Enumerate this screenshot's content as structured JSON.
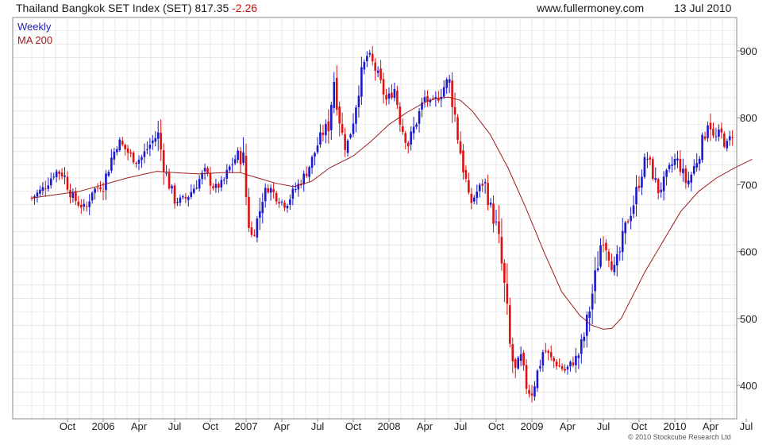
{
  "header": {
    "title": "Thailand Bangkok SET Index (SET) 817.35",
    "change": "-2.26",
    "site": "www.fullermoney.com",
    "date": "13 Jul 2010"
  },
  "legend": {
    "weekly": "Weekly",
    "ma": "MA 200"
  },
  "credit": "© 2010 Stockcube Research Ltd",
  "colors": {
    "up": "#1a1acc",
    "down": "#dd1111",
    "ma": "#9b1c1c",
    "grid": "#dcdcdc"
  },
  "chart_data": {
    "type": "candlestick",
    "x_unit": "months since Jul 2005",
    "x_ticks": [
      {
        "m": 3,
        "label": "Oct"
      },
      {
        "m": 6,
        "label": "2006"
      },
      {
        "m": 9,
        "label": "Apr"
      },
      {
        "m": 12,
        "label": "Jul"
      },
      {
        "m": 15,
        "label": "Oct"
      },
      {
        "m": 18,
        "label": "2007"
      },
      {
        "m": 21,
        "label": "Apr"
      },
      {
        "m": 24,
        "label": "Jul"
      },
      {
        "m": 27,
        "label": "Oct"
      },
      {
        "m": 30,
        "label": "2008"
      },
      {
        "m": 33,
        "label": "Apr"
      },
      {
        "m": 36,
        "label": "Jul"
      },
      {
        "m": 39,
        "label": "Oct"
      },
      {
        "m": 42,
        "label": "2009"
      },
      {
        "m": 45,
        "label": "Apr"
      },
      {
        "m": 48,
        "label": "Jul"
      },
      {
        "m": 51,
        "label": "Oct"
      },
      {
        "m": 54,
        "label": "2010"
      },
      {
        "m": 57,
        "label": "Apr"
      },
      {
        "m": 60,
        "label": "Jul"
      }
    ],
    "y_ticks": [
      400,
      500,
      600,
      700,
      800,
      900
    ],
    "ylim": [
      350,
      950
    ],
    "xlim": [
      0,
      60.6
    ],
    "price_path": [
      [
        0,
        680
      ],
      [
        1,
        695
      ],
      [
        2,
        720
      ],
      [
        2.7,
        715
      ],
      [
        3.3,
        685
      ],
      [
        4,
        670
      ],
      [
        4.6,
        665
      ],
      [
        5,
        690
      ],
      [
        6,
        700
      ],
      [
        6.7,
        740
      ],
      [
        7.3,
        765
      ],
      [
        8,
        750
      ],
      [
        8.7,
        735
      ],
      [
        9.2,
        740
      ],
      [
        10,
        762
      ],
      [
        10.6,
        775
      ],
      [
        11.2,
        720
      ],
      [
        12,
        675
      ],
      [
        13,
        680
      ],
      [
        13.8,
        700
      ],
      [
        14.5,
        720
      ],
      [
        15.3,
        695
      ],
      [
        16,
        700
      ],
      [
        16.6,
        725
      ],
      [
        17.3,
        745
      ],
      [
        17.8,
        730
      ],
      [
        18.1,
        660
      ],
      [
        18.4,
        620
      ],
      [
        19,
        650
      ],
      [
        19.5,
        690
      ],
      [
        20,
        695
      ],
      [
        20.6,
        680
      ],
      [
        21.3,
        670
      ],
      [
        22,
        690
      ],
      [
        22.8,
        710
      ],
      [
        23.5,
        735
      ],
      [
        24.2,
        770
      ],
      [
        24.9,
        790
      ],
      [
        25.4,
        860
      ],
      [
        26,
        780
      ],
      [
        26.4,
        750
      ],
      [
        27,
        800
      ],
      [
        27.6,
        860
      ],
      [
        28.2,
        895
      ],
      [
        28.8,
        875
      ],
      [
        29.3,
        850
      ],
      [
        29.8,
        825
      ],
      [
        30.5,
        845
      ],
      [
        31,
        790
      ],
      [
        31.6,
        760
      ],
      [
        32.3,
        795
      ],
      [
        33,
        830
      ],
      [
        33.6,
        820
      ],
      [
        34.3,
        835
      ],
      [
        35,
        860
      ],
      [
        35.4,
        820
      ],
      [
        35.8,
        770
      ],
      [
        36.3,
        720
      ],
      [
        36.8,
        670
      ],
      [
        37.4,
        690
      ],
      [
        38,
        705
      ],
      [
        38.6,
        660
      ],
      [
        39.1,
        630
      ],
      [
        39.6,
        560
      ],
      [
        40.2,
        450
      ],
      [
        40.6,
        420
      ],
      [
        41,
        445
      ],
      [
        41.5,
        400
      ],
      [
        41.9,
        385
      ],
      [
        42.4,
        415
      ],
      [
        43,
        455
      ],
      [
        43.6,
        440
      ],
      [
        44.2,
        430
      ],
      [
        44.8,
        422
      ],
      [
        45.3,
        432
      ],
      [
        45.9,
        445
      ],
      [
        46.4,
        475
      ],
      [
        46.9,
        520
      ],
      [
        47.5,
        580
      ],
      [
        47.9,
        625
      ],
      [
        48.4,
        600
      ],
      [
        48.9,
        570
      ],
      [
        49.4,
        600
      ],
      [
        49.9,
        640
      ],
      [
        50.5,
        670
      ],
      [
        51,
        705
      ],
      [
        51.6,
        745
      ],
      [
        52.1,
        720
      ],
      [
        52.6,
        690
      ],
      [
        53,
        700
      ],
      [
        53.6,
        725
      ],
      [
        54.1,
        740
      ],
      [
        54.5,
        725
      ],
      [
        55,
        700
      ],
      [
        55.5,
        720
      ],
      [
        56,
        745
      ],
      [
        56.5,
        775
      ],
      [
        56.9,
        800
      ],
      [
        57.3,
        765
      ],
      [
        57.8,
        780
      ],
      [
        58.3,
        755
      ],
      [
        58.8,
        775
      ],
      [
        59.3,
        790
      ],
      [
        59.8,
        805
      ],
      [
        60.5,
        818
      ]
    ],
    "ma_200": [
      [
        0,
        680
      ],
      [
        4,
        690
      ],
      [
        8,
        710
      ],
      [
        10.5,
        720
      ],
      [
        12,
        718
      ],
      [
        14,
        716
      ],
      [
        16,
        718
      ],
      [
        17.5,
        718
      ],
      [
        19,
        710
      ],
      [
        20.5,
        702
      ],
      [
        22,
        697
      ],
      [
        23.5,
        705
      ],
      [
        25,
        725
      ],
      [
        27,
        743
      ],
      [
        28.5,
        765
      ],
      [
        30,
        790
      ],
      [
        31.5,
        808
      ],
      [
        33,
        823
      ],
      [
        34,
        829
      ],
      [
        35,
        831
      ],
      [
        36,
        826
      ],
      [
        37,
        810
      ],
      [
        38.5,
        775
      ],
      [
        40,
        725
      ],
      [
        41.5,
        665
      ],
      [
        43,
        600
      ],
      [
        44.5,
        540
      ],
      [
        46,
        505
      ],
      [
        47,
        490
      ],
      [
        48,
        484
      ],
      [
        48.7,
        485
      ],
      [
        49.5,
        500
      ],
      [
        50.5,
        535
      ],
      [
        51.5,
        570
      ],
      [
        53,
        615
      ],
      [
        54.5,
        660
      ],
      [
        56,
        690
      ],
      [
        57.5,
        710
      ],
      [
        59,
        725
      ],
      [
        60.5,
        738
      ]
    ]
  }
}
